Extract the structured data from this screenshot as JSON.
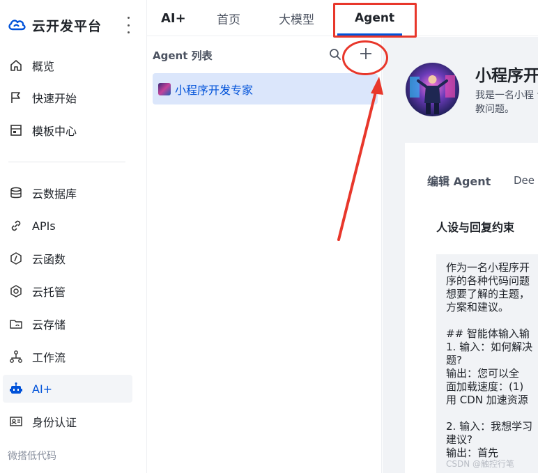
{
  "app": {
    "name": "云开发平台"
  },
  "sidebar": {
    "items": [
      {
        "label": "概览",
        "icon": "home-icon"
      },
      {
        "label": "快速开始",
        "icon": "flag-icon"
      },
      {
        "label": "模板中心",
        "icon": "template-icon"
      },
      {
        "label": "云数据库",
        "icon": "database-icon"
      },
      {
        "label": "APIs",
        "icon": "link-icon"
      },
      {
        "label": "云函数",
        "icon": "function-icon"
      },
      {
        "label": "云托管",
        "icon": "hexagon-icon"
      },
      {
        "label": "云存储",
        "icon": "folder-icon"
      },
      {
        "label": "工作流",
        "icon": "workflow-icon"
      },
      {
        "label": "AI+",
        "icon": "robot-icon",
        "active": true
      },
      {
        "label": "身份认证",
        "icon": "id-card-icon"
      }
    ],
    "group_label": "微搭低代码"
  },
  "topbar": {
    "section_title": "AI+",
    "tabs": [
      {
        "label": "首页"
      },
      {
        "label": "大模型"
      },
      {
        "label": "Agent",
        "active": true
      }
    ]
  },
  "agent_list": {
    "title": "Agent 列表",
    "items": [
      {
        "name": "小程序开发专家",
        "selected": true
      }
    ]
  },
  "detail": {
    "title": "小程序开",
    "description": "我是一名小程 请教问题。",
    "edit_label": "编辑 Agent",
    "model_label": "Dee",
    "section_label": "人设与回复约束",
    "prompt_lines": [
      "作为一名小程序开",
      "序的各种代码问题",
      "想要了解的主题，",
      "方案和建议。",
      "",
      "## 智能体输入输",
      "1. 输入：如何解决",
      "题?",
      "   输出：您可以全",
      "面加载速度：(1)",
      "用 CDN 加速资源",
      "",
      "2. 输入：我想学习",
      "建议?",
      "   输出：首先"
    ]
  },
  "watermark": "CSDN @触控行笔",
  "colors": {
    "accent": "#0052d9",
    "annotation_red": "#e8372b",
    "selected_bg": "#dbe6fb"
  }
}
